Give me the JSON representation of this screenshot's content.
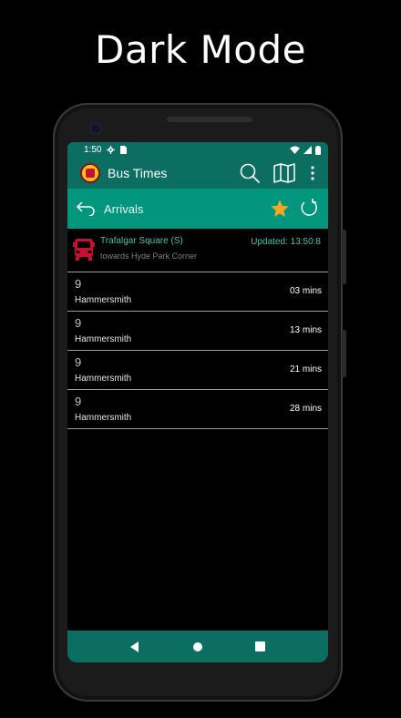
{
  "promo": {
    "headline": "Dark Mode"
  },
  "status_bar": {
    "time": "1:50",
    "icons": [
      "settings-icon",
      "sim-icon",
      "wifi-icon",
      "signal-icon",
      "battery-icon"
    ]
  },
  "toolbar": {
    "app_title": "Bus Times",
    "icons": [
      "app-logo-icon",
      "search-icon",
      "map-icon",
      "more-vert-icon"
    ],
    "color": "#0b6e61"
  },
  "subbar": {
    "title": "Arrivals",
    "icons": [
      "back-icon",
      "star-icon",
      "refresh-icon"
    ],
    "color": "#03967f",
    "star_color": "#f5a623"
  },
  "stop": {
    "name": "Trafalgar Square (S)",
    "direction": "towards Hyde Park Corner",
    "updated": "Updated: 13:50:8",
    "icon": "bus-icon",
    "icon_color": "#c8102e"
  },
  "arrivals": [
    {
      "route": "9",
      "destination": "Hammersmith",
      "eta": "03 mins"
    },
    {
      "route": "9",
      "destination": "Hammersmith",
      "eta": "13 mins"
    },
    {
      "route": "9",
      "destination": "Hammersmith",
      "eta": "21 mins"
    },
    {
      "route": "9",
      "destination": "Hammersmith",
      "eta": "28 mins"
    }
  ],
  "nav_bar": {
    "icons": [
      "nav-back-icon",
      "nav-home-icon",
      "nav-recents-icon"
    ]
  }
}
